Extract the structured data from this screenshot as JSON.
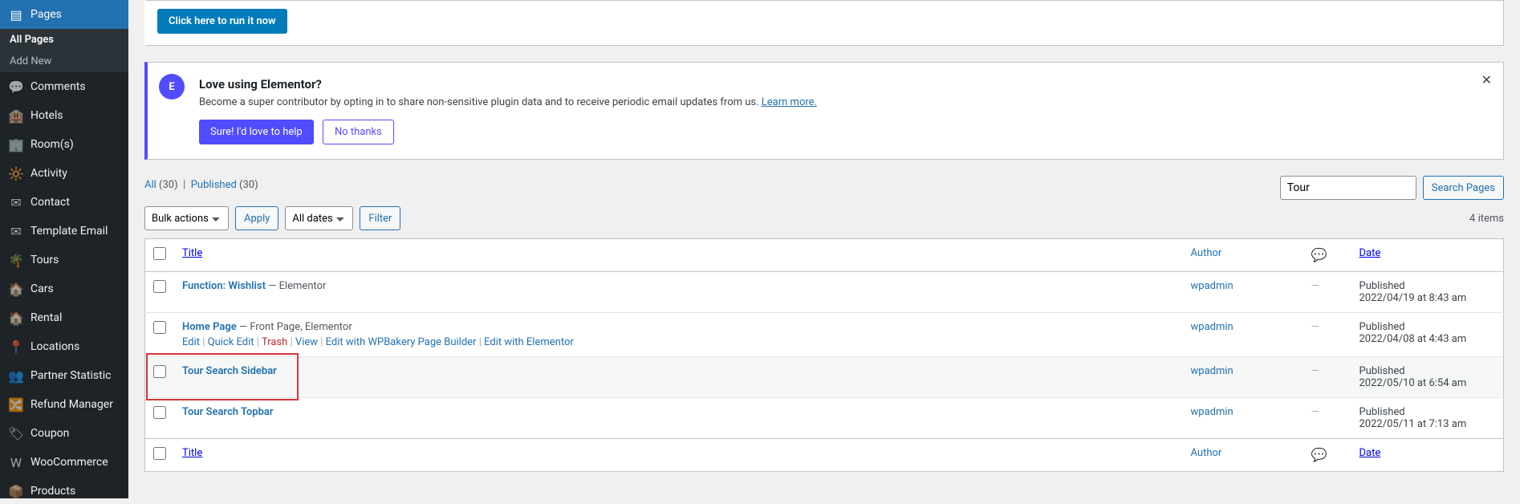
{
  "sidebar": {
    "active": {
      "label": "Pages"
    },
    "sub": [
      {
        "label": "All Pages",
        "current": true
      },
      {
        "label": "Add New",
        "current": false
      }
    ],
    "items": [
      {
        "label": "Comments",
        "icon": "💬"
      },
      {
        "label": "Hotels",
        "icon": "🏨"
      },
      {
        "label": "Room(s)",
        "icon": "🏢"
      },
      {
        "label": "Activity",
        "icon": "🔆"
      },
      {
        "label": "Contact",
        "icon": "✉"
      },
      {
        "label": "Template Email",
        "icon": "✉"
      },
      {
        "label": "Tours",
        "icon": "🌴"
      },
      {
        "label": "Cars",
        "icon": "🏠"
      },
      {
        "label": "Rental",
        "icon": "🏠"
      },
      {
        "label": "Locations",
        "icon": "📍"
      },
      {
        "label": "Partner Statistic",
        "icon": "👥"
      },
      {
        "label": "Refund Manager",
        "icon": "🔀"
      },
      {
        "label": "Coupon",
        "icon": "🏷"
      },
      {
        "label": "WooCommerce",
        "icon": "W"
      },
      {
        "label": "Products",
        "icon": "📦"
      }
    ]
  },
  "notices": {
    "run_btn": "Click here to run it now",
    "elementor": {
      "title": "Love using Elementor?",
      "text": "Become a super contributor by opting in to share non-sensitive plugin data and to receive periodic email updates from us. ",
      "learn_more": "Learn more.",
      "yes": "Sure! I'd love to help",
      "no": "No thanks",
      "badge": "E"
    }
  },
  "filters": {
    "all": "All",
    "all_count": "(30)",
    "published": "Published",
    "published_count": "(30)"
  },
  "search": {
    "value": "Tour",
    "button": "Search Pages"
  },
  "bulk": {
    "actions": "Bulk actions",
    "apply": "Apply",
    "dates": "All dates",
    "filter": "Filter"
  },
  "count_text": "4 items",
  "columns": {
    "title": "Title",
    "author": "Author",
    "date": "Date"
  },
  "rows": [
    {
      "title": "Function: Wishlist",
      "suffix": " — Elementor",
      "author": "wpadmin",
      "comments": "—",
      "status": "Published",
      "date": "2022/04/19 at 8:43 am",
      "actions": null
    },
    {
      "title": "Home Page",
      "suffix": " — Front Page, Elementor",
      "author": "wpadmin",
      "comments": "—",
      "status": "Published",
      "date": "2022/04/08 at 4:43 am",
      "actions": [
        "Edit",
        "Quick Edit",
        "Trash",
        "View",
        "Edit with WPBakery Page Builder",
        "Edit with Elementor"
      ]
    },
    {
      "title": "Tour Search Sidebar",
      "suffix": "",
      "author": "wpadmin",
      "comments": "—",
      "status": "Published",
      "date": "2022/05/10 at 6:54 am",
      "actions": null,
      "highlight": true
    },
    {
      "title": "Tour Search Topbar",
      "suffix": "",
      "author": "wpadmin",
      "comments": "—",
      "status": "Published",
      "date": "2022/05/11 at 7:13 am",
      "actions": null
    }
  ]
}
